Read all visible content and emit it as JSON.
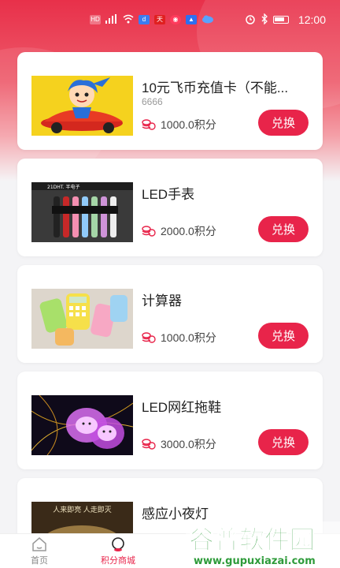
{
  "status_bar": {
    "left_icons": [
      "hd-signal-icon",
      "signal-4g-icon",
      "wifi-icon",
      "app-icon-1",
      "app-icon-2",
      "app-icon-3",
      "app-icon-4",
      "cloud-icon"
    ],
    "time": "12:00"
  },
  "products": [
    {
      "title": "10元飞币充值卡（不能...",
      "subtitle": "6666",
      "price": "1000.0积分",
      "button": "兑换",
      "image": "cartoon-car-image"
    },
    {
      "title": "LED手表",
      "subtitle": "",
      "price": "2000.0积分",
      "button": "兑换",
      "image": "led-watch-image"
    },
    {
      "title": "计算器",
      "subtitle": "",
      "price": "1000.0积分",
      "button": "兑换",
      "image": "calculator-image"
    },
    {
      "title": "LED网红拖鞋",
      "subtitle": "",
      "price": "3000.0积分",
      "button": "兑换",
      "image": "led-slippers-image"
    },
    {
      "title": "感应小夜灯",
      "subtitle": "",
      "price": "",
      "button": "",
      "image": "night-light-image"
    }
  ],
  "night_light_caption": "人来即亮 人走即灭",
  "tabbar": {
    "items": [
      {
        "label": "首页",
        "icon": "home-icon",
        "active": false
      },
      {
        "label": "积分商城",
        "icon": "points-mall-icon",
        "active": true
      }
    ]
  },
  "watermark": {
    "title": "谷普软件园",
    "url": "www.gupuxiazai.com"
  },
  "colors": {
    "accent": "#e8244a",
    "header_gradient_top": "#e8304a"
  }
}
